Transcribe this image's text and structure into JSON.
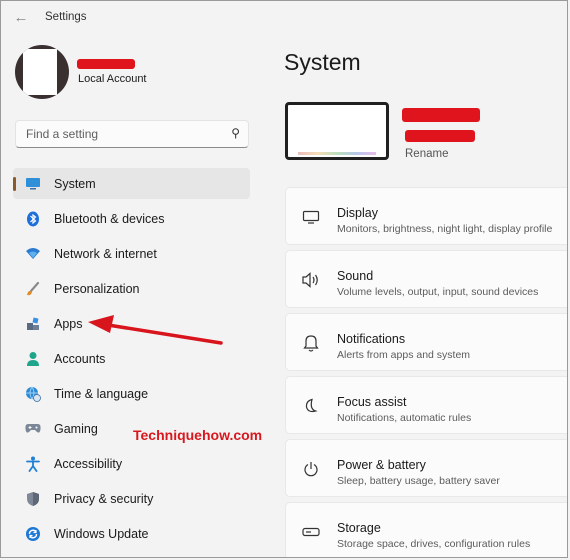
{
  "titlebar": {
    "title": "Settings",
    "back_icon": "back-arrow-icon"
  },
  "profile": {
    "account_type": "Local Account"
  },
  "search": {
    "placeholder": "Find a setting"
  },
  "nav": {
    "items": [
      {
        "label": "System",
        "icon": "monitor-icon",
        "active": true
      },
      {
        "label": "Bluetooth & devices",
        "icon": "bluetooth-icon"
      },
      {
        "label": "Network & internet",
        "icon": "wifi-icon"
      },
      {
        "label": "Personalization",
        "icon": "brush-icon"
      },
      {
        "label": "Apps",
        "icon": "apps-icon"
      },
      {
        "label": "Accounts",
        "icon": "person-icon"
      },
      {
        "label": "Time & language",
        "icon": "globe-clock-icon"
      },
      {
        "label": "Gaming",
        "icon": "gamepad-icon"
      },
      {
        "label": "Accessibility",
        "icon": "accessibility-icon"
      },
      {
        "label": "Privacy & security",
        "icon": "shield-icon"
      },
      {
        "label": "Windows Update",
        "icon": "update-icon"
      }
    ]
  },
  "watermark": "Techniquehow.com",
  "main": {
    "title": "System",
    "device": {
      "rename_label": "Rename"
    },
    "cards": [
      {
        "title": "Display",
        "desc": "Monitors, brightness, night light, display profile",
        "icon": "display-icon"
      },
      {
        "title": "Sound",
        "desc": "Volume levels, output, input, sound devices",
        "icon": "speaker-icon"
      },
      {
        "title": "Notifications",
        "desc": "Alerts from apps and system",
        "icon": "bell-icon"
      },
      {
        "title": "Focus assist",
        "desc": "Notifications, automatic rules",
        "icon": "moon-icon"
      },
      {
        "title": "Power & battery",
        "desc": "Sleep, battery usage, battery saver",
        "icon": "power-icon"
      },
      {
        "title": "Storage",
        "desc": "Storage space, drives, configuration rules",
        "icon": "storage-icon"
      }
    ]
  },
  "colors": {
    "accent_indicator": "#8a5a2b",
    "redaction": "#e0141c",
    "watermark": "#d8181e",
    "window_bg": "#f3f3f3"
  }
}
